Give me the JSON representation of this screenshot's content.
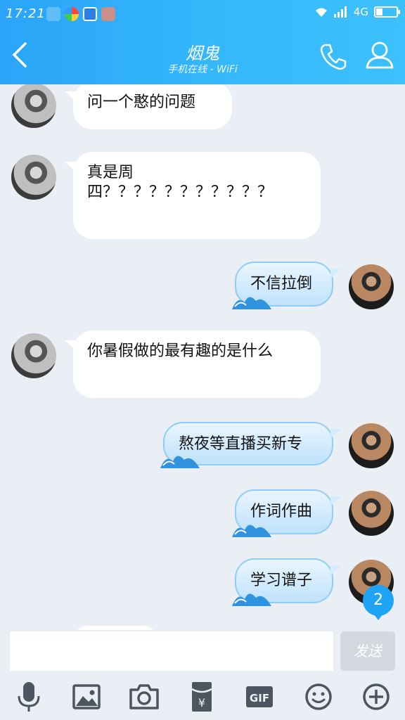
{
  "status_bar": {
    "time": "17:21",
    "network": "4G"
  },
  "header": {
    "title": "烟鬼",
    "subtitle": "手机在线 - WiFi"
  },
  "messages": [
    {
      "from": "peer",
      "text": "问一个憨的问题"
    },
    {
      "from": "peer",
      "text": "真是周四？？？？？？？？？？？"
    },
    {
      "from": "me",
      "text": "不信拉倒"
    },
    {
      "from": "peer",
      "text": "你暑假做的最有趣的是什么"
    },
    {
      "from": "me",
      "text": "熬夜等直播买新专"
    },
    {
      "from": "me",
      "text": "作词作曲"
    },
    {
      "from": "me",
      "text": "学习谱子"
    }
  ],
  "unread_badge": "2",
  "input": {
    "value": "",
    "placeholder": ""
  },
  "send_label": "发送",
  "toolbar_icons": [
    "microphone-icon",
    "image-icon",
    "camera-icon",
    "red-packet-icon",
    "gif-icon",
    "emoji-icon",
    "plus-icon"
  ],
  "gif_label": "GIF",
  "colors": {
    "header_start": "#2aa4f8",
    "header_end": "#3dc1fb",
    "background": "#eaeff6",
    "badge": "#1fa3f4",
    "icon": "#4c5560"
  }
}
